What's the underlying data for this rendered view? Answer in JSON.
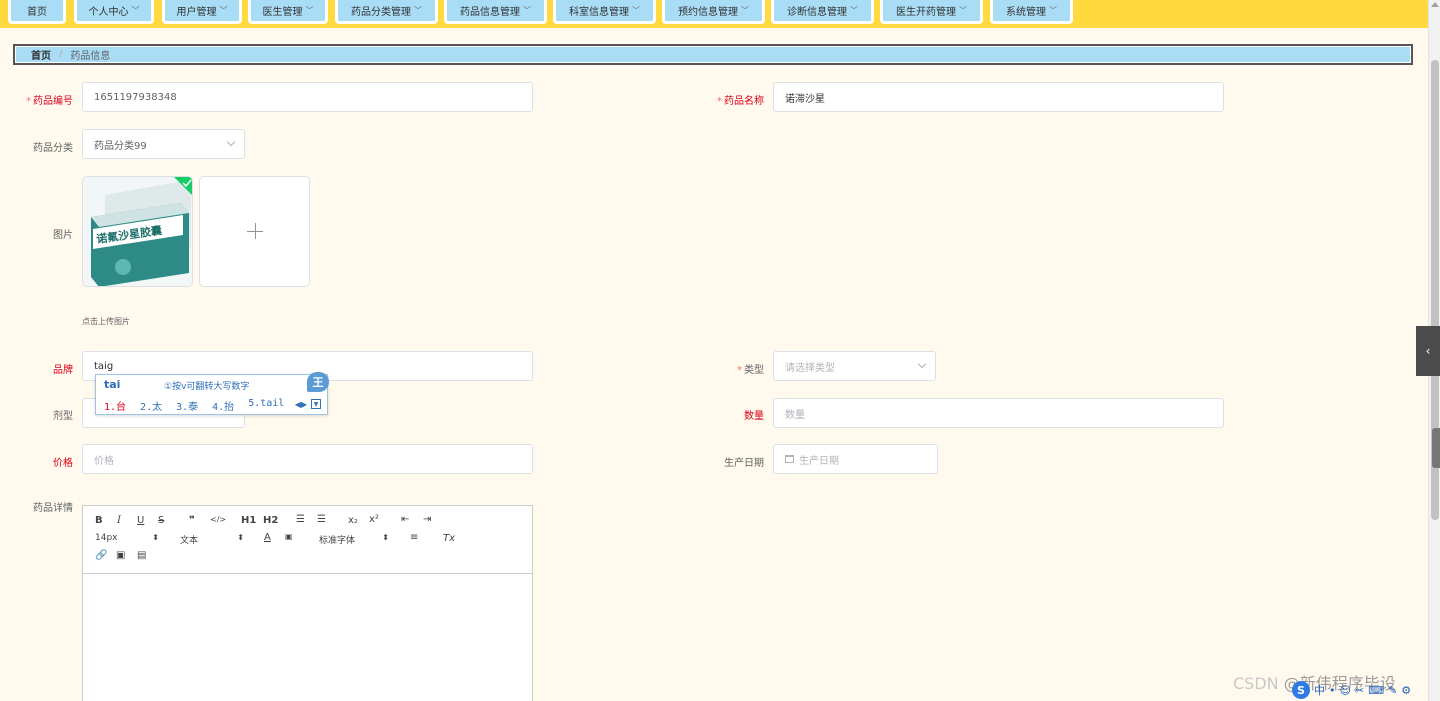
{
  "nav": {
    "items": [
      {
        "label": "首页",
        "dropdown": false
      },
      {
        "label": "个人中心",
        "dropdown": true
      },
      {
        "label": "用户管理",
        "dropdown": true
      },
      {
        "label": "医生管理",
        "dropdown": true
      },
      {
        "label": "药品分类管理",
        "dropdown": true
      },
      {
        "label": "药品信息管理",
        "dropdown": true
      },
      {
        "label": "科室信息管理",
        "dropdown": true
      },
      {
        "label": "预约信息管理",
        "dropdown": true
      },
      {
        "label": "诊断信息管理",
        "dropdown": true
      },
      {
        "label": "医生开药管理",
        "dropdown": true
      },
      {
        "label": "系统管理",
        "dropdown": true
      }
    ]
  },
  "breadcrumb": {
    "home": "首页",
    "separator": "/",
    "current": "药品信息"
  },
  "form": {
    "drug_code": {
      "label": "药品编号",
      "value": "1651197938348",
      "required": true
    },
    "drug_name": {
      "label": "药品名称",
      "value": "诺滞沙星",
      "required": true
    },
    "category": {
      "label": "药品分类",
      "value": "药品分类99"
    },
    "image": {
      "label": "图片",
      "hint": "点击上传图片",
      "product_text": "诺氟沙星胶囊"
    },
    "brand": {
      "label": "品牌",
      "value": "taig"
    },
    "type": {
      "label": "类型",
      "placeholder": "请选择类型",
      "required": true
    },
    "dosage": {
      "label": "剂型"
    },
    "quantity": {
      "label": "数量",
      "placeholder": "数量"
    },
    "price": {
      "label": "价格",
      "placeholder": "价格"
    },
    "production_date": {
      "label": "生产日期",
      "placeholder": "生产日期"
    },
    "details": {
      "label": "药品详情"
    }
  },
  "editor": {
    "font_size": "14px",
    "text_type": "文本",
    "font_family": "标准字体",
    "buttons": [
      "B",
      "I",
      "U",
      "S",
      "❞",
      "</>",
      "H1",
      "H2",
      "ol",
      "ul",
      "x₂",
      "x²",
      "outdent",
      "indent",
      "A",
      "bg",
      "align",
      "Tx",
      "link",
      "image",
      "video"
    ]
  },
  "ime": {
    "code": "tai",
    "hint": "①按v可翻转大写数字",
    "candidates": [
      "1.台",
      "2.太",
      "3.泰",
      "4.抬",
      "5.tail"
    ],
    "logo": "王"
  },
  "watermark": {
    "site": "CSDN",
    "author": "@新伟程序毕设"
  },
  "colors": {
    "nav_bg": "#ffd93d",
    "nav_btn": "#a9dcf5",
    "page_bg": "#fffaed",
    "required": "#f56c6c",
    "label_red": "#d9001b"
  }
}
